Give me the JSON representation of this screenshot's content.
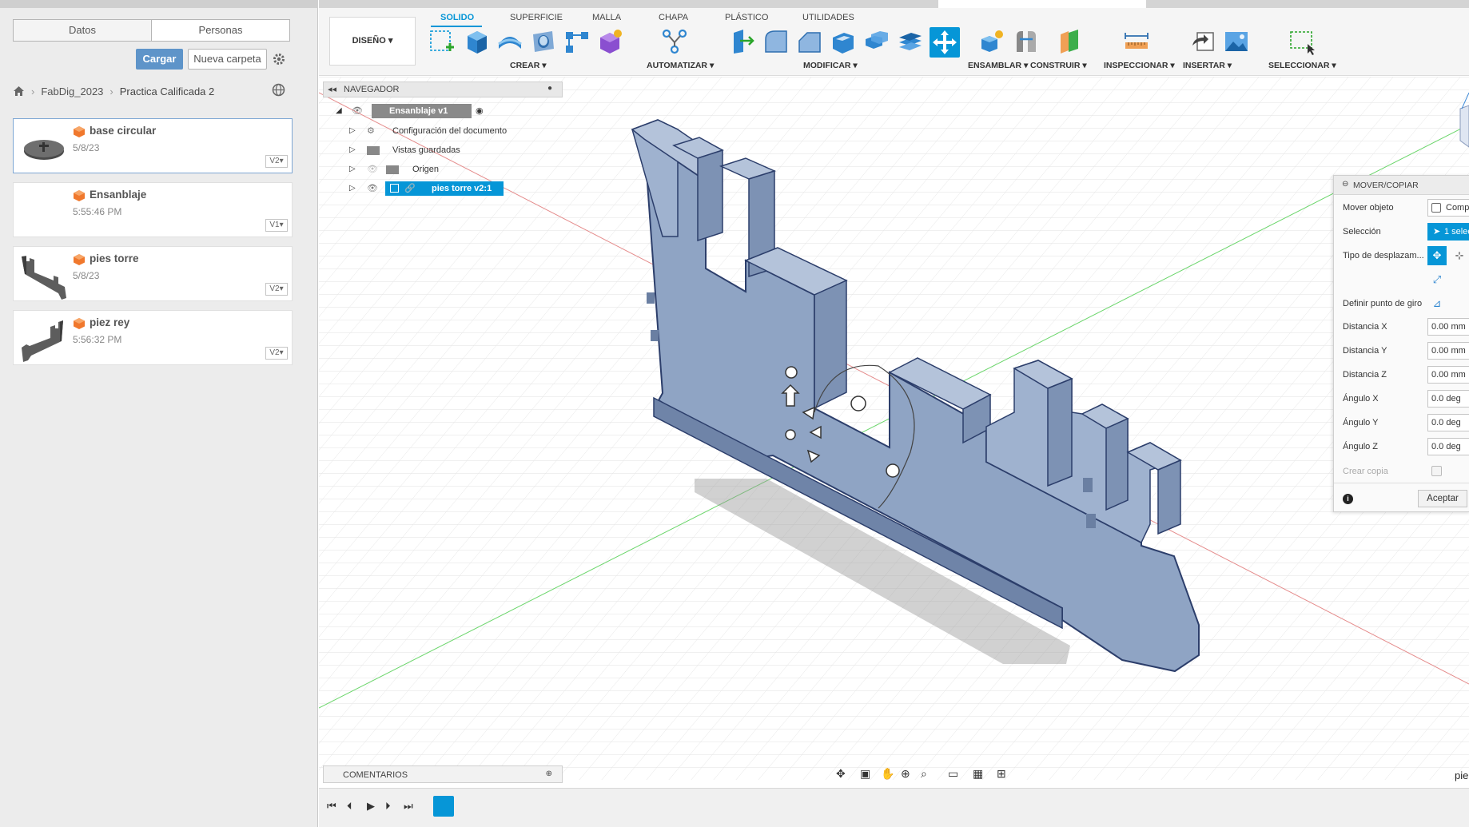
{
  "left_panel": {
    "tabs": {
      "datos": "Datos",
      "personas": "Personas"
    },
    "buttons": {
      "cargar": "Cargar",
      "nueva_carpeta": "Nueva carpeta"
    },
    "breadcrumb": [
      "FabDig_2023",
      "Practica Calificada 2"
    ],
    "files": [
      {
        "name": "base circular",
        "date": "5/8/23",
        "version": "V2"
      },
      {
        "name": "Ensanblaje",
        "date": "5:55:46 PM",
        "version": "V1"
      },
      {
        "name": "pies torre",
        "date": "5/8/23",
        "version": "V2"
      },
      {
        "name": "piez rey",
        "date": "5:56:32 PM",
        "version": "V2"
      }
    ]
  },
  "toolbar": {
    "workspace": "DISEÑO",
    "tabs": [
      "SOLIDO",
      "SUPERFICIE",
      "MALLA",
      "CHAPA",
      "PLÁSTICO",
      "UTILIDADES"
    ],
    "groups": [
      "CREAR",
      "AUTOMATIZAR",
      "MODIFICAR",
      "ENSAMBLAR",
      "CONSTRUIR",
      "INSPECCIONAR",
      "INSERTAR",
      "SELECCIONAR"
    ]
  },
  "navigator": {
    "title": "NAVEGADOR",
    "root": "Ensanblaje v1",
    "items": [
      "Configuración del documento",
      "Vistas guardadas",
      "Origen",
      "pies torre v2:1"
    ]
  },
  "comments": {
    "title": "COMENTARIOS"
  },
  "dialog": {
    "title": "MOVER/COPIAR",
    "mover_objeto": {
      "label": "Mover objeto",
      "value": "Compo"
    },
    "seleccion": {
      "label": "Selección",
      "value": "1 selec"
    },
    "tipo": {
      "label": "Tipo de desplazam..."
    },
    "punto": {
      "label": "Definir punto de giro"
    },
    "fields": [
      {
        "label": "Distancia X",
        "value": "0.00 mm"
      },
      {
        "label": "Distancia Y",
        "value": "0.00 mm"
      },
      {
        "label": "Distancia Z",
        "value": "0.00 mm"
      },
      {
        "label": "Ángulo X",
        "value": "0.0 deg"
      },
      {
        "label": "Ángulo Y",
        "value": "0.0 deg"
      },
      {
        "label": "Ángulo Z",
        "value": "0.0 deg"
      }
    ],
    "crear_copia": "Crear copia",
    "aceptar": "Aceptar"
  },
  "viewport_label": "pie",
  "colors": {
    "accent": "#0696d7",
    "button_blue": "#5e94c9",
    "model_fill": "#8fa4c4",
    "selected_row": "#0696d7",
    "fusion_orange": "#f0782d"
  }
}
